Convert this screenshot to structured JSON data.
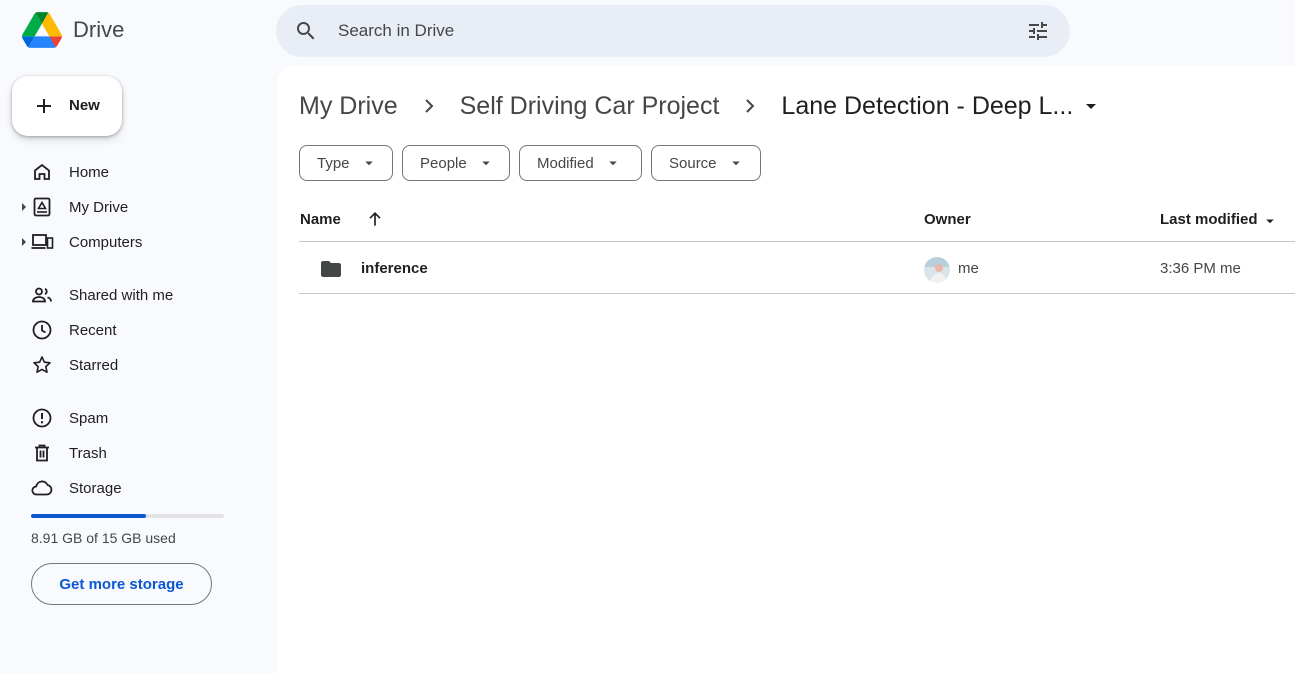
{
  "app": {
    "title": "Drive"
  },
  "search": {
    "placeholder": "Search in Drive",
    "icon": "search-icon",
    "options_icon": "tune-icon"
  },
  "sidebar": {
    "new_label": "New",
    "items": [
      {
        "label": "Home",
        "icon": "home-icon"
      },
      {
        "label": "My Drive",
        "icon": "my-drive-icon"
      },
      {
        "label": "Computers",
        "icon": "computers-icon"
      },
      {
        "label": "Shared with me",
        "icon": "shared-icon"
      },
      {
        "label": "Recent",
        "icon": "clock-icon"
      },
      {
        "label": "Starred",
        "icon": "star-icon"
      },
      {
        "label": "Spam",
        "icon": "spam-icon"
      },
      {
        "label": "Trash",
        "icon": "trash-icon"
      },
      {
        "label": "Storage",
        "icon": "cloud-icon"
      }
    ],
    "storage": {
      "used_fraction": 0.594,
      "text": "8.91 GB of 15 GB used",
      "button": "Get more storage"
    }
  },
  "breadcrumb": [
    "My Drive",
    "Self Driving Car Project",
    "Lane Detection - Deep L..."
  ],
  "filters": [
    "Type",
    "People",
    "Modified",
    "Source"
  ],
  "table": {
    "columns": {
      "name": "Name",
      "owner": "Owner",
      "modified": "Last modified"
    },
    "rows": [
      {
        "name": "inference",
        "owner": "me",
        "modified": "3:36 PM me",
        "icon": "folder-icon"
      }
    ]
  },
  "colors": {
    "accent": "#0b57d0",
    "background": "#f8fafd",
    "search_bg": "#e9eef6"
  }
}
